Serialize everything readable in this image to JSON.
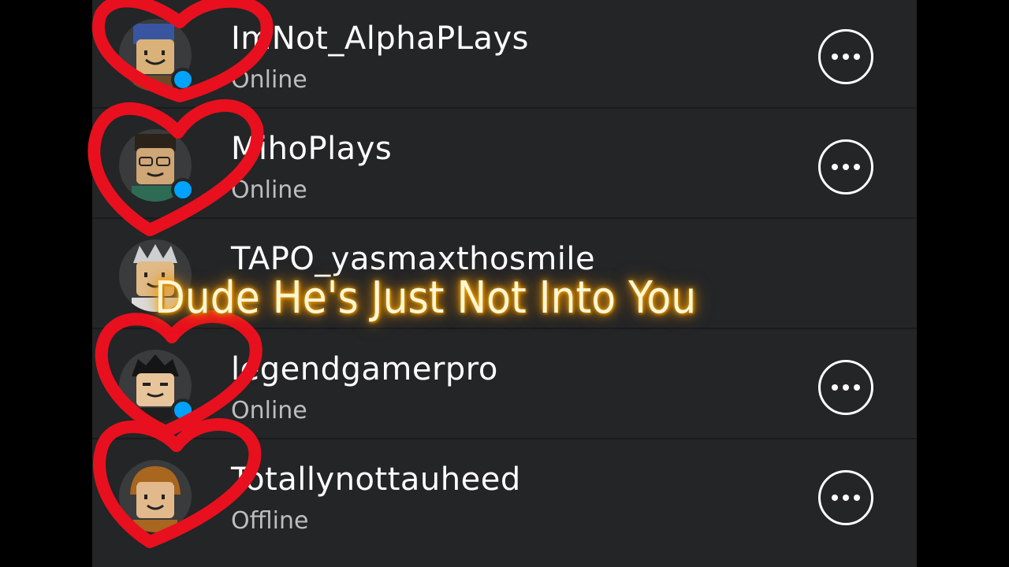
{
  "friends": [
    {
      "username": "ImNot_AlphaPLays",
      "status": "Online",
      "menu_icon": "more-options-icon"
    },
    {
      "username": "MihoPlays",
      "status": "Online",
      "menu_icon": "more-options-icon"
    },
    {
      "username": "TAPO_yasmaxthosmile",
      "status": "",
      "menu_icon": ""
    },
    {
      "username": "legendgamerpro",
      "status": "Online",
      "menu_icon": "more-options-icon"
    },
    {
      "username": "Totallynottauheed",
      "status": "Offline",
      "menu_icon": "more-options-icon"
    }
  ],
  "overlay": {
    "caption": "Dude He's Just Not Into You",
    "scribble_color": "#e8101e",
    "caption_glow_color": "#ffa500"
  },
  "colors": {
    "panel_bg": "#232527",
    "text_primary": "#ffffff",
    "text_secondary": "#bcbebe",
    "presence_online": "#00a2ff"
  }
}
